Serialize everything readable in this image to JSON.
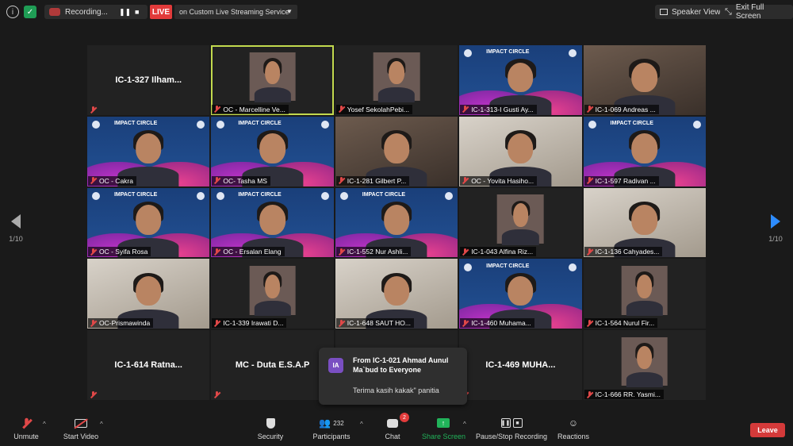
{
  "topbar": {
    "recording_label": "Recording...",
    "live_badge": "LIVE",
    "live_service": "on Custom Live Streaming Service",
    "speaker_view": "Speaker View",
    "exit_full_screen": "Exit Full Screen"
  },
  "pager": {
    "left": "1/10",
    "right": "1/10"
  },
  "tiles": [
    {
      "name": "IC-1-327  Ilham...",
      "label": "",
      "video": "none"
    },
    {
      "name": "",
      "label": "OC - Marcelline Ve...",
      "video": "inset",
      "active": true
    },
    {
      "name": "",
      "label": "Yosef SekolahPebi...",
      "video": "inset"
    },
    {
      "name": "",
      "label": "IC-1-313-I Gusti Ay...",
      "video": "banner"
    },
    {
      "name": "",
      "label": "IC-1-069 Andreas ...",
      "video": "room"
    },
    {
      "name": "",
      "label": "OC - Cakra",
      "video": "banner"
    },
    {
      "name": "",
      "label": "OC- Tasha MS",
      "video": "banner"
    },
    {
      "name": "",
      "label": "IC-1-281 Gilbert P...",
      "video": "room"
    },
    {
      "name": "",
      "label": "OC - Yovita Hasiho...",
      "video": "light"
    },
    {
      "name": "",
      "label": "IC-1-597 Radivan ...",
      "video": "banner"
    },
    {
      "name": "",
      "label": "OC - Syifa Rosa",
      "video": "banner"
    },
    {
      "name": "",
      "label": "OC - Ersalan Elang",
      "video": "banner"
    },
    {
      "name": "",
      "label": "IC-1-552 Nur Ashli...",
      "video": "banner"
    },
    {
      "name": "",
      "label": "IC-1-043 Alfina Riz...",
      "video": "inset"
    },
    {
      "name": "",
      "label": "IC-1-136 Cahyades...",
      "video": "light"
    },
    {
      "name": "",
      "label": "OC-Prismawinda",
      "video": "light"
    },
    {
      "name": "",
      "label": "IC-1-339 Irawati D...",
      "video": "inset"
    },
    {
      "name": "",
      "label": "IC-1-648 SAUT HO...",
      "video": "light"
    },
    {
      "name": "",
      "label": "IC-1-460 Muhama...",
      "video": "banner"
    },
    {
      "name": "",
      "label": "IC-1-564 Nurul Fir...",
      "video": "inset"
    },
    {
      "name": "IC-1-614  Ratna...",
      "label": "",
      "video": "none"
    },
    {
      "name": "MC - Duta E.S.A.P",
      "label": "",
      "video": "none"
    },
    {
      "name": "",
      "label": "",
      "video": "none"
    },
    {
      "name": "IC-1-469  MUHA...",
      "label": "",
      "video": "none"
    },
    {
      "name": "",
      "label": "IC-1-666 RR. Yasmi...",
      "video": "inset"
    }
  ],
  "banner_title": "IMPACT CIRCLE",
  "toast": {
    "avatar": "IA",
    "from": "From IC-1-021 Ahmad Aunul Ma`bud to Everyone",
    "message": "Terima kasih kakak\" panitia"
  },
  "toolbar": {
    "unmute": "Unmute",
    "start_video": "Start Video",
    "security": "Security",
    "participants": "Participants",
    "participants_count": "232",
    "chat": "Chat",
    "chat_badge": "2",
    "share_screen": "Share Screen",
    "pause_recording": "Pause/Stop Recording",
    "reactions": "Reactions",
    "leave": "Leave"
  },
  "colors": {
    "live_red": "#e23b3b",
    "active_speaker": "#c2d94e",
    "share_green": "#21b35a",
    "banner_blue": "#1f4a8a"
  }
}
